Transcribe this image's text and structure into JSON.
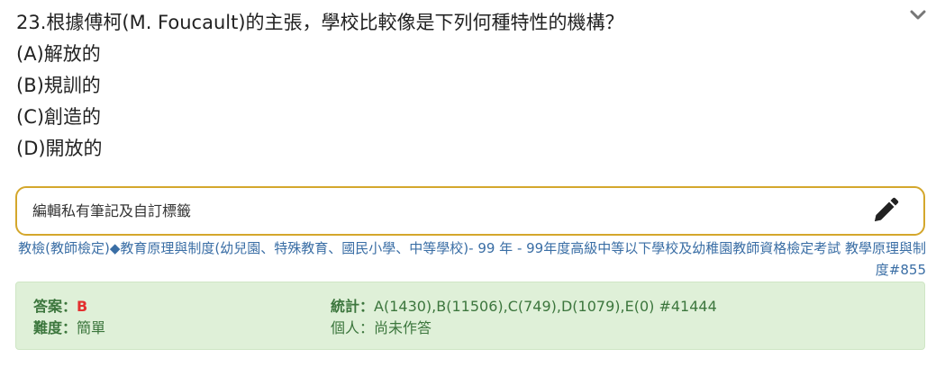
{
  "question": {
    "stem": "23.根據傅柯(M. Foucault)的主張，學校比較像是下列何種特性的機構？",
    "options": [
      "(A)解放的",
      "(B)規訓的",
      "(C)創造的",
      "(D)開放的"
    ]
  },
  "note": {
    "placeholder": "編輯私有筆記及自訂標籤"
  },
  "breadcrumb": {
    "category": "教檢(教師檢定)",
    "separator": "◆",
    "subject": "教育原理與制度(幼兒園、特殊教育、國民小學、中等學校)",
    "exam_prefix": "- 99 年 - ",
    "exam_title": "99年度高級中等以下學校及幼稚園教師資格檢定考試 教學原理與制度#855"
  },
  "answer_panel": {
    "answer_label": "答案：",
    "answer_value": "B",
    "difficulty_label": "難度：",
    "difficulty_value": "簡單",
    "stats_label": "統計：",
    "stats_value": "A(1430),B(11506),C(749),D(1079),E(0) #41444",
    "personal_label": "個人：",
    "personal_value": "尚未作答"
  },
  "colors": {
    "note_border": "#d4a72c",
    "link": "#3a6ea5",
    "panel_bg": "#dff0d8",
    "panel_text": "#3c763d",
    "answer_red": "#e3302f"
  },
  "icons": {
    "collapse": "chevron-down-icon",
    "edit": "pencil-icon"
  }
}
